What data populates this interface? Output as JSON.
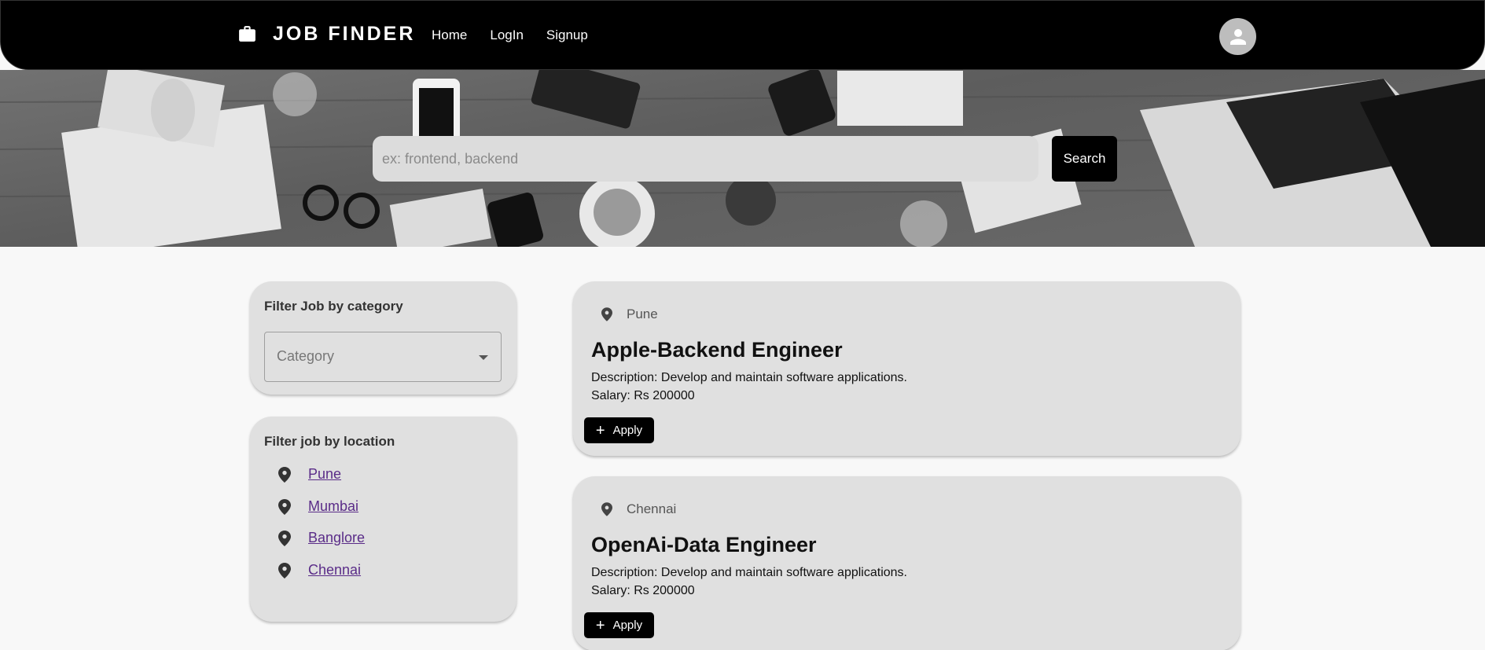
{
  "navbar": {
    "brand_icon": "briefcase-icon",
    "brand_title": "JOB FINDER",
    "links": [
      "Home",
      "LogIn",
      "Signup"
    ],
    "avatar_icon": "person-icon"
  },
  "search": {
    "placeholder": "ex: frontend, backend",
    "button_label": "Search"
  },
  "filters": {
    "category": {
      "title": "Filter Job by category",
      "select_label": "Category"
    },
    "location": {
      "title": "Filter job by location",
      "items": [
        "Pune",
        "Mumbai",
        "Banglore",
        "Chennai"
      ]
    }
  },
  "jobs": [
    {
      "location": "Pune",
      "title": "Apple-Backend Engineer",
      "description": "Description: Develop and maintain software applications.",
      "salary": "Salary: Rs 200000",
      "apply_label": "Apply"
    },
    {
      "location": "Chennai",
      "title": "OpenAi-Data Engineer",
      "description": "Description: Develop and maintain software applications.",
      "salary": "Salary: Rs 200000",
      "apply_label": "Apply"
    }
  ],
  "colors": {
    "navbar_bg": "#000000",
    "card_bg": "#e0e0e0",
    "link": "#5a2c88",
    "page_bg": "#f8f8f8"
  }
}
